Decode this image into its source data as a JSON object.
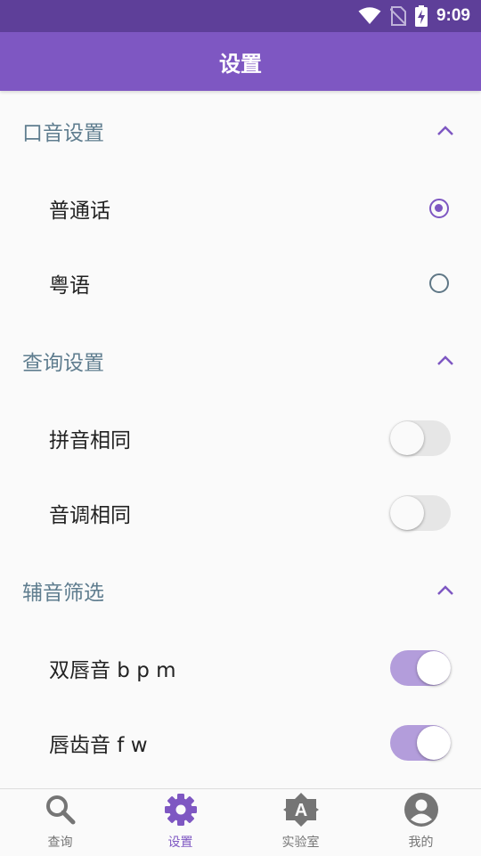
{
  "status_bar": {
    "time": "9:09",
    "icons": [
      "wifi-icon",
      "no-sim-icon",
      "battery-charging-icon"
    ]
  },
  "app_bar": {
    "title": "设置"
  },
  "sections": [
    {
      "title": "口音设置",
      "expanded": true,
      "items": [
        {
          "label": "普通话",
          "control": "radio",
          "selected": true
        },
        {
          "label": "粤语",
          "control": "radio",
          "selected": false
        }
      ]
    },
    {
      "title": "查询设置",
      "expanded": true,
      "items": [
        {
          "label": "拼音相同",
          "control": "switch",
          "on": false
        },
        {
          "label": "音调相同",
          "control": "switch",
          "on": false
        }
      ]
    },
    {
      "title": "辅音筛选",
      "expanded": true,
      "items": [
        {
          "label": "双唇音 b p m",
          "control": "switch",
          "on": true
        },
        {
          "label": "唇齿音 f w",
          "control": "switch",
          "on": true
        }
      ]
    }
  ],
  "bottom_nav": {
    "items": [
      {
        "label": "查询",
        "icon": "search-icon",
        "active": false
      },
      {
        "label": "设置",
        "icon": "gear-icon",
        "active": true
      },
      {
        "label": "实验室",
        "icon": "lab-badge-icon",
        "active": false
      },
      {
        "label": "我的",
        "icon": "account-icon",
        "active": false
      }
    ]
  },
  "colors": {
    "primary": "#7e57c2",
    "primary_dark": "#5e3f99",
    "section_text": "#5f7d8f",
    "switch_on_track": "#b39ddb"
  }
}
